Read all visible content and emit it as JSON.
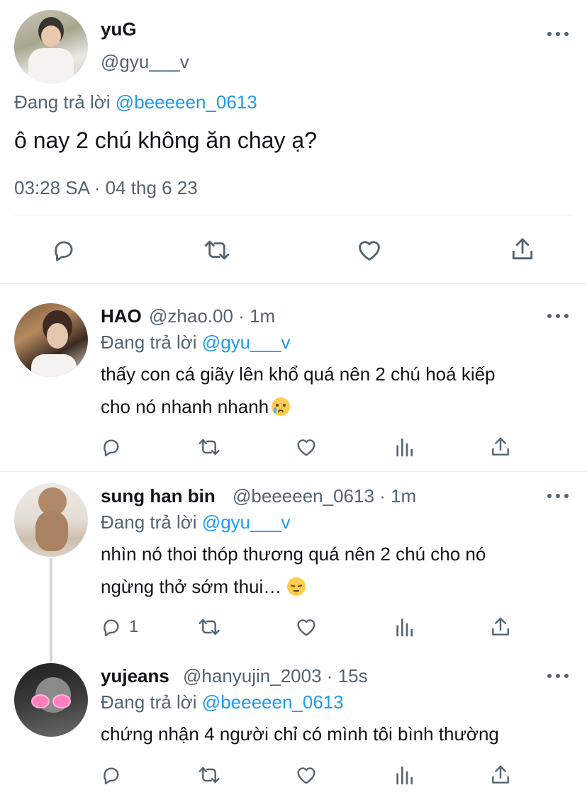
{
  "main_tweet": {
    "name": "yuG",
    "handle": "@gyu___v",
    "reply_prefix": "Đang trả lời",
    "reply_to": "@beeeeen_0613",
    "text": "ô nay 2 chú không ăn chay ạ?",
    "timestamp": "03:28 SA · 04 thg 6 23",
    "actions": [
      "reply-icon",
      "retweet-icon",
      "like-icon",
      "share-icon"
    ]
  },
  "replies": [
    {
      "name": "HAO",
      "handle": "@zhao.00",
      "dot": "·",
      "time": "1m",
      "reply_prefix": "Đang trả lời",
      "reply_to": "@gyu___v",
      "text_line1": "thấy con cá giãy lên khổ quá nên 2 chú hoá kiếp",
      "text_line2": "cho nó nhanh nhanh",
      "emoji": "crying-face",
      "reply_count": ""
    },
    {
      "name": "sung han bin",
      "handle": "@beeeeen_0613",
      "dot": "·",
      "time": "1m",
      "reply_prefix": "Đang trả lời",
      "reply_to": "@gyu___v",
      "text_line1": "nhìn nó thoi thóp thương quá nên 2 chú cho nó",
      "text_line2": "ngừng thở sớm thui…",
      "emoji": "pensive-face",
      "reply_count": "1"
    },
    {
      "name": "yujeans",
      "handle": "@hanyujin_2003",
      "dot": "·",
      "time": "15s",
      "reply_prefix": "Đang trả lời",
      "reply_to": "@beeeeen_0613",
      "text_line1": "chứng nhận 4 người chỉ có mình tôi bình thường",
      "reply_count": ""
    }
  ],
  "colors": {
    "text": "#0f1419",
    "secondary": "#536471",
    "accent": "#1d9bf0",
    "divider": "#e6ecf0"
  }
}
